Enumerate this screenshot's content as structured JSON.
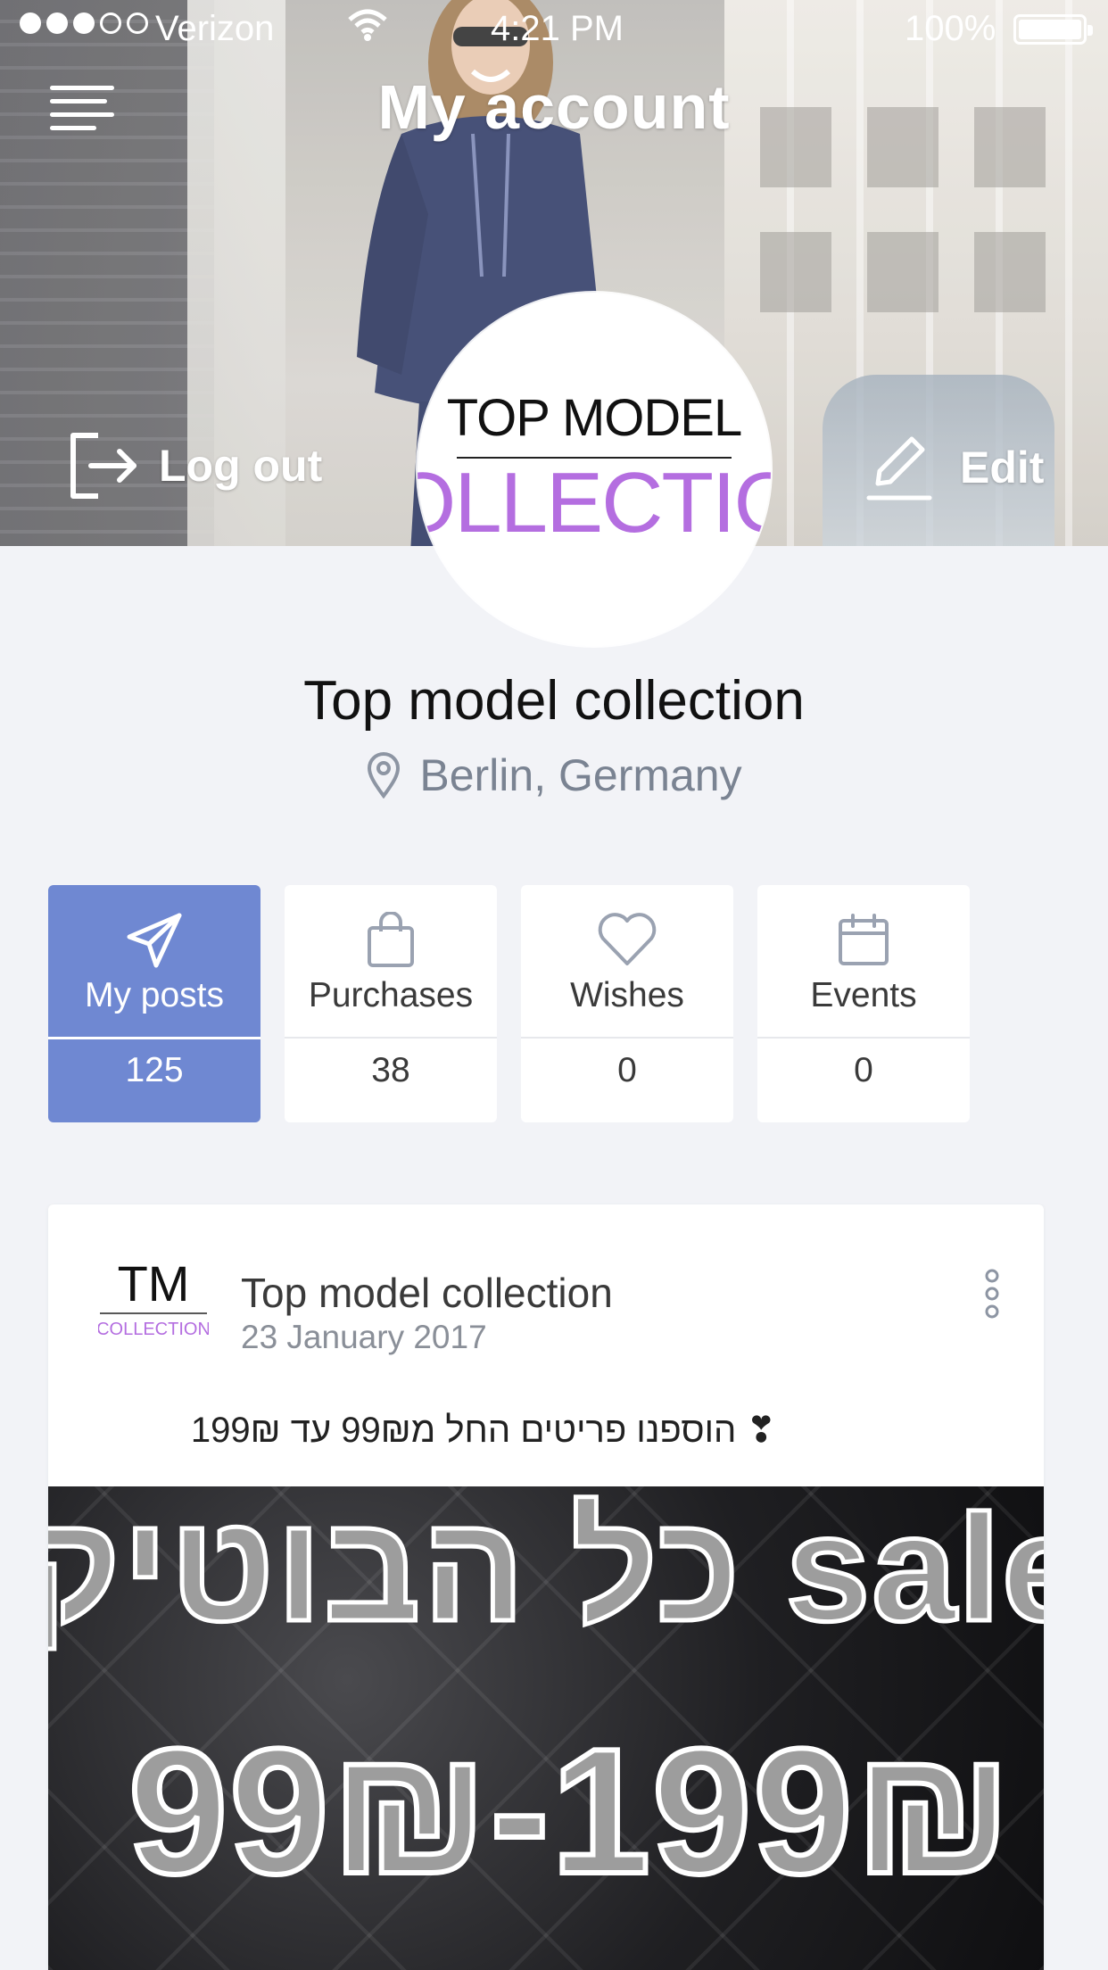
{
  "status_bar": {
    "carrier": "Verizon",
    "time": "4:21 PM",
    "battery_percent": "100%",
    "signal_bars_filled": 3,
    "signal_bars_total": 5
  },
  "header": {
    "title": "My account",
    "logout_label": "Log out",
    "edit_label": "Edit"
  },
  "avatar": {
    "logo_line1": "TOP MODEL",
    "logo_line2": "COLLECTION"
  },
  "profile": {
    "name": "Top model collection",
    "location": "Berlin, Germany"
  },
  "tabs": [
    {
      "label": "My posts",
      "count": "125",
      "icon": "send-icon",
      "active": true
    },
    {
      "label": "Purchases",
      "count": "38",
      "icon": "shopping-bag-icon",
      "active": false
    },
    {
      "label": "Wishes",
      "count": "0",
      "icon": "heart-icon",
      "active": false
    },
    {
      "label": "Events",
      "count": "0",
      "icon": "calendar-icon",
      "active": false
    }
  ],
  "post": {
    "logo_line1": "TM",
    "logo_line2": "COLLECTION",
    "author": "Top model collection",
    "date": "23 January 2017",
    "text": "❣ הוספנו פריטים החל מ99₪ עד 199₪",
    "image_text_line1": "כל הבוטיק sale",
    "image_text_line2": "99₪-199₪"
  },
  "colors": {
    "accent": "#6f88d2",
    "background": "#f2f3f7",
    "logo_purple": "#b46ee0",
    "muted_text": "#7a8392"
  }
}
